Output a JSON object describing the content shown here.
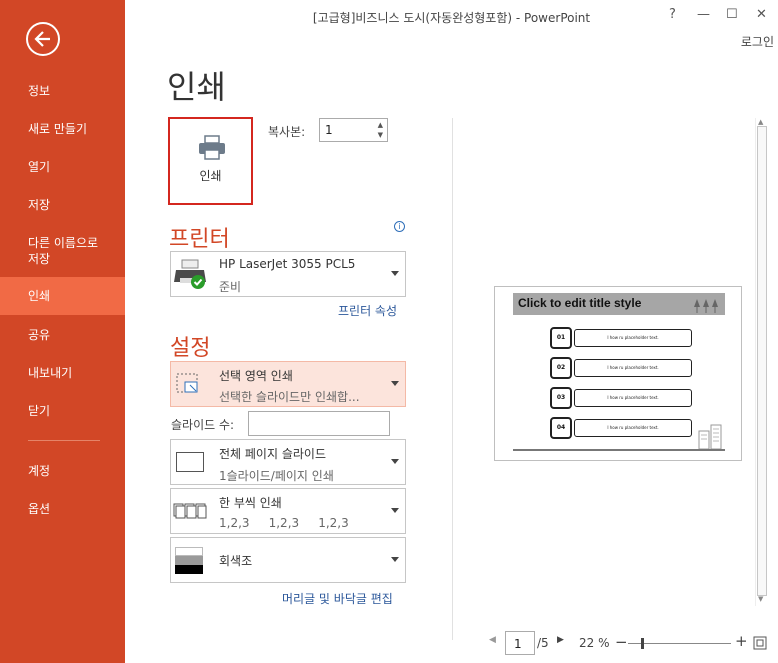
{
  "window": {
    "title": "[고급형]비즈니스 도시(자동완성형포함) - PowerPoint",
    "help": "?",
    "minimize": "—",
    "maximize": "☐",
    "close": "✕",
    "login": "로그인"
  },
  "sidebar": {
    "accent_color": "#d24726",
    "active_color": "#f16a45",
    "items": [
      {
        "label": "정보"
      },
      {
        "label": "새로 만들기"
      },
      {
        "label": "열기"
      },
      {
        "label": "저장"
      },
      {
        "label": "다른 이름으로\n저장"
      },
      {
        "label": "인쇄"
      },
      {
        "label": "공유"
      },
      {
        "label": "내보내기"
      },
      {
        "label": "닫기"
      },
      {
        "label": "계정"
      },
      {
        "label": "옵션"
      }
    ]
  },
  "main": {
    "title": "인쇄",
    "print_button": "인쇄",
    "copies_label": "복사본:",
    "copies_value": "1"
  },
  "printer": {
    "section_title": "프린터",
    "name": "HP LaserJet 3055 PCL5",
    "status": "준비",
    "properties_link": "프린터 속성"
  },
  "settings": {
    "section_title": "설정",
    "range": {
      "title": "선택 영역 인쇄",
      "desc": "선택한 슬라이드만 인쇄합..."
    },
    "slides_label": "슬라이드 수:",
    "slides_value": "",
    "layout": {
      "title": "전체 페이지 슬라이드",
      "desc": "1슬라이드/페이지 인쇄"
    },
    "collate": {
      "title": "한 부씩 인쇄",
      "desc": "1,2,3     1,2,3     1,2,3"
    },
    "color": {
      "title": "회색조"
    },
    "header_footer_link": "머리글 및 바닥글 편집"
  },
  "preview": {
    "slide_title": "Click to edit title style",
    "rows": [
      {
        "num": "01",
        "text": "I how ru placeholder text."
      },
      {
        "num": "02",
        "text": "I how ru placeholder text."
      },
      {
        "num": "03",
        "text": "I how ru placeholder text."
      },
      {
        "num": "04",
        "text": "I how ru placeholder text."
      }
    ]
  },
  "status": {
    "page_current": "1",
    "page_total": "/5",
    "zoom": "22 %",
    "zoom_level": 0.22
  }
}
